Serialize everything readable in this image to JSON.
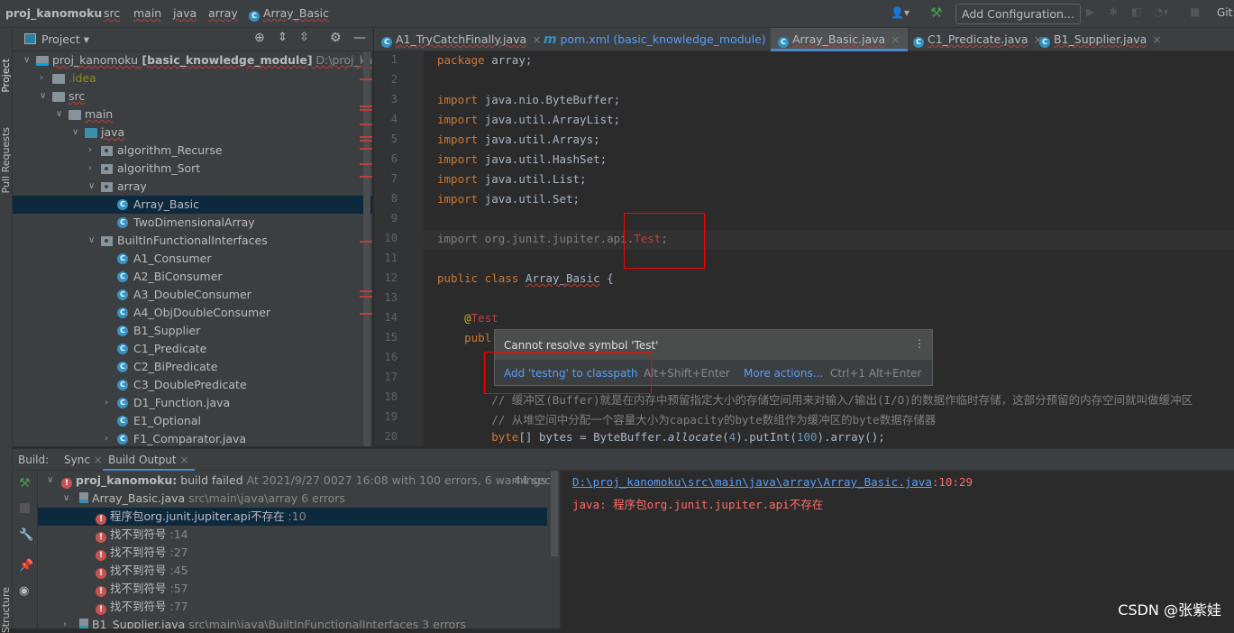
{
  "breadcrumb": [
    "proj_kanomoku",
    "src",
    "main",
    "java",
    "array",
    "Array_Basic"
  ],
  "toolbar": {
    "add_config": "Add Configuration...",
    "git": "Git:"
  },
  "left_strip": {
    "project": "Project",
    "pull_requests": "Pull Requests",
    "structure": "Structure"
  },
  "project_panel": {
    "title": "Project"
  },
  "tree": [
    {
      "level": 0,
      "arrow": "open",
      "icon": "module",
      "label": "proj_kanomoku",
      "bold": "[basic_knowledge_module]",
      "path": "D:\\proj_kanomoku"
    },
    {
      "level": 1,
      "arrow": "closed",
      "icon": "folder",
      "label": ".idea",
      "color": "#8c8c1c"
    },
    {
      "level": 1,
      "arrow": "open",
      "icon": "folder",
      "label": "src"
    },
    {
      "level": 2,
      "arrow": "open",
      "icon": "folder",
      "label": "main"
    },
    {
      "level": 3,
      "arrow": "open",
      "icon": "folder-blue",
      "label": "java"
    },
    {
      "level": 4,
      "arrow": "closed",
      "icon": "package",
      "label": "algorithm_Recurse"
    },
    {
      "level": 4,
      "arrow": "closed",
      "icon": "package",
      "label": "algorithm_Sort"
    },
    {
      "level": 4,
      "arrow": "open",
      "icon": "package",
      "label": "array"
    },
    {
      "level": 5,
      "icon": "class",
      "label": "Array_Basic",
      "selected": true
    },
    {
      "level": 5,
      "icon": "class",
      "label": "TwoDimensionalArray"
    },
    {
      "level": 4,
      "arrow": "open",
      "icon": "package",
      "label": "BuiltInFunctionalInterfaces"
    },
    {
      "level": 5,
      "icon": "class",
      "label": "A1_Consumer"
    },
    {
      "level": 5,
      "icon": "class",
      "label": "A2_BiConsumer"
    },
    {
      "level": 5,
      "icon": "class",
      "label": "A3_DoubleConsumer"
    },
    {
      "level": 5,
      "icon": "class",
      "label": "A4_ObjDoubleConsumer"
    },
    {
      "level": 5,
      "icon": "class",
      "label": "B1_Supplier"
    },
    {
      "level": 5,
      "icon": "class",
      "label": "C1_Predicate"
    },
    {
      "level": 5,
      "icon": "class",
      "label": "C2_BiPredicate"
    },
    {
      "level": 5,
      "icon": "class",
      "label": "C3_DoublePredicate"
    },
    {
      "level": 5,
      "arrow": "closed",
      "icon": "class",
      "label": "D1_Function.java"
    },
    {
      "level": 5,
      "icon": "class",
      "label": "E1_Optional"
    },
    {
      "level": 5,
      "arrow": "closed",
      "icon": "class",
      "label": "F1_Comparator.java"
    }
  ],
  "tabs": [
    {
      "label": "A1_TryCatchFinally.java",
      "icon": "class"
    },
    {
      "label": "pom.xml (basic_knowledge_module)",
      "icon": "maven",
      "link": true
    },
    {
      "label": "Array_Basic.java",
      "icon": "class",
      "active": true
    },
    {
      "label": "C1_Predicate.java",
      "icon": "class"
    },
    {
      "label": "B1_Supplier.java",
      "icon": "class"
    }
  ],
  "code": [
    [
      [
        "kw",
        "package "
      ],
      [
        "",
        "array;"
      ]
    ],
    [],
    [
      [
        "kw",
        "import "
      ],
      [
        "",
        "java.nio.ByteBuffer;"
      ]
    ],
    [
      [
        "kw",
        "import "
      ],
      [
        "",
        "java.util.ArrayList;"
      ]
    ],
    [
      [
        "kw",
        "import "
      ],
      [
        "",
        "java.util.Arrays;"
      ]
    ],
    [
      [
        "kw",
        "import "
      ],
      [
        "",
        "java.util.HashSet;"
      ]
    ],
    [
      [
        "kw",
        "import "
      ],
      [
        "",
        "java.util.List;"
      ]
    ],
    [
      [
        "kw",
        "import "
      ],
      [
        "",
        "java.util.Set;"
      ]
    ],
    [],
    [
      [
        "dim",
        "import org.junit.jupiter.api."
      ],
      [
        "err",
        "Test"
      ],
      [
        "dim",
        ";"
      ]
    ],
    [],
    [
      [
        "kw",
        "public class "
      ],
      [
        "sq",
        "Array_Basic"
      ],
      [
        "",
        " {"
      ]
    ],
    [],
    [
      [
        "",
        "    "
      ],
      [
        "an",
        "@"
      ],
      [
        "err",
        "Test"
      ]
    ],
    [
      [
        "",
        "    "
      ],
      [
        "kw",
        "publ"
      ]
    ],
    [],
    [],
    [
      [
        "cm",
        "        // 缓冲区(Buffer)就是在内存中预留指定大小的存储空间用来对输入/输出(I/O)的数据作临时存储，这部分预留的内存空间就叫做缓冲区"
      ]
    ],
    [
      [
        "cm",
        "        // 从堆空间中分配一个容量大小为capacity的byte数组作为缓冲区的byte数据存储器"
      ]
    ],
    [
      [
        "",
        "        "
      ],
      [
        "kw",
        "byte"
      ],
      [
        "",
        "[] bytes = ByteBuffer."
      ],
      [
        "it",
        "allocate"
      ],
      [
        "",
        "("
      ],
      [
        "num",
        "4"
      ],
      [
        "",
        ").putInt("
      ],
      [
        "num",
        "100"
      ],
      [
        "",
        ").array();"
      ]
    ]
  ],
  "popup": {
    "message": "Cannot resolve symbol 'Test'",
    "action1": "Add 'testng' to classpath",
    "shortcut1": "Alt+Shift+Enter",
    "action2": "More actions...",
    "shortcut2": "Ctrl+1 Alt+Enter"
  },
  "build": {
    "label": "Build:",
    "tab_sync": "Sync",
    "tab_output": "Build Output",
    "root": {
      "name": "proj_kanomoku:",
      "status": "build failed",
      "detail": "At 2021/9/27 0027 16:08 with 100 errors, 6 warnings",
      "time": "44 sec"
    },
    "file": {
      "name": "Array_Basic.java",
      "path": "src\\main\\java\\array 6 errors"
    },
    "errors": [
      {
        "msg": "程序包org.junit.jupiter.api不存在",
        "line": ":10",
        "selected": true
      },
      {
        "msg": "找不到符号",
        "line": ":14"
      },
      {
        "msg": "找不到符号",
        "line": ":27"
      },
      {
        "msg": "找不到符号",
        "line": ":45"
      },
      {
        "msg": "找不到符号",
        "line": ":57"
      },
      {
        "msg": "找不到符号",
        "line": ":77"
      }
    ],
    "file2": {
      "name": "B1_Supplier.java",
      "path": "src\\main\\java\\BuiltInFunctionalInterfaces 3 errors"
    }
  },
  "console": {
    "path": "D:\\proj_kanomoku\\src\\main\\java\\array\\Array_Basic.java",
    "pos": ":10:29",
    "message": "java: 程序包org.junit.jupiter.api不存在"
  },
  "watermark": "CSDN @张紫娃"
}
